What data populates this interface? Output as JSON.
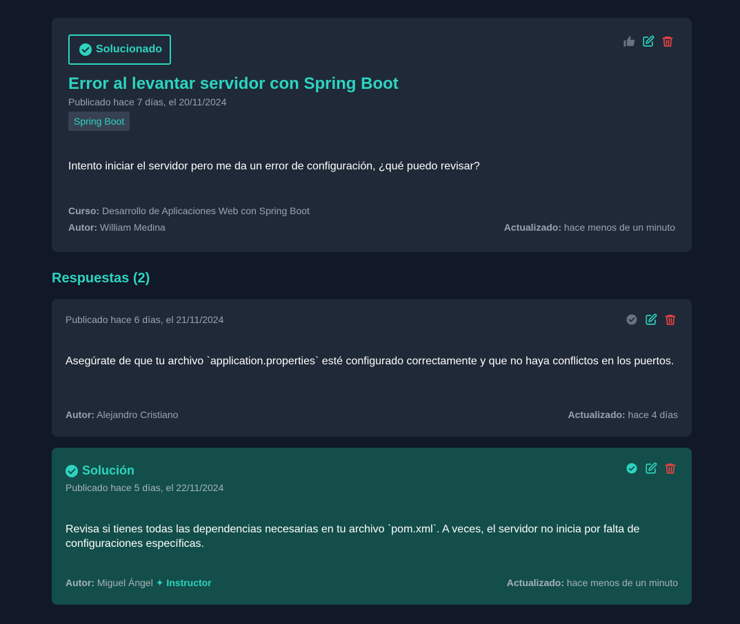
{
  "topic": {
    "status_badge": "Solucionado",
    "title": "Error al levantar servidor con Spring Boot",
    "published": "Publicado hace 7 días, el 20/11/2024",
    "tag": "Spring Boot",
    "body": "Intento iniciar el servidor pero me da un error de configuración, ¿qué puedo revisar?",
    "course_label": "Curso:",
    "course": "Desarrollo de Aplicaciones Web con Spring Boot",
    "author_label": "Autor:",
    "author": "William Medina",
    "updated_label": "Actualizado:",
    "updated": "hace menos de un minuto",
    "icons": [
      "thumbs-up-icon",
      "edit-icon",
      "trash-icon"
    ]
  },
  "replies_heading": "Respuestas (2)",
  "replies": [
    {
      "published": "Publicado hace 6 días, el 21/11/2024",
      "body": "Asegúrate de que tu archivo `application.properties` esté configurado correctamente y que no haya conflictos en los puertos.",
      "author_label": "Autor:",
      "author": "Alejandro Cristiano",
      "updated_label": "Actualizado:",
      "updated": "hace 4 días",
      "icons": [
        "mark-solution-icon",
        "edit-icon",
        "trash-icon"
      ]
    },
    {
      "solution_label": "Solución",
      "published": "Publicado hace 5 días, el 22/11/2024",
      "body": "Revisa si tienes todas las dependencias necesarias en tu archivo `pom.xml`. A veces, el servidor no inicia por falta de configuraciones específicas.",
      "author_label": "Autor:",
      "author": "Miguel Ángel",
      "author_role": "✦ Instructor",
      "updated_label": "Actualizado:",
      "updated": "hace menos de un minuto",
      "icons": [
        "mark-solution-icon",
        "edit-icon",
        "trash-icon"
      ]
    }
  ],
  "colors": {
    "accent": "#2dd4bf",
    "danger": "#ef4444",
    "card": "#1f2937",
    "solution_card": "#134e4a",
    "background": "#111827"
  }
}
